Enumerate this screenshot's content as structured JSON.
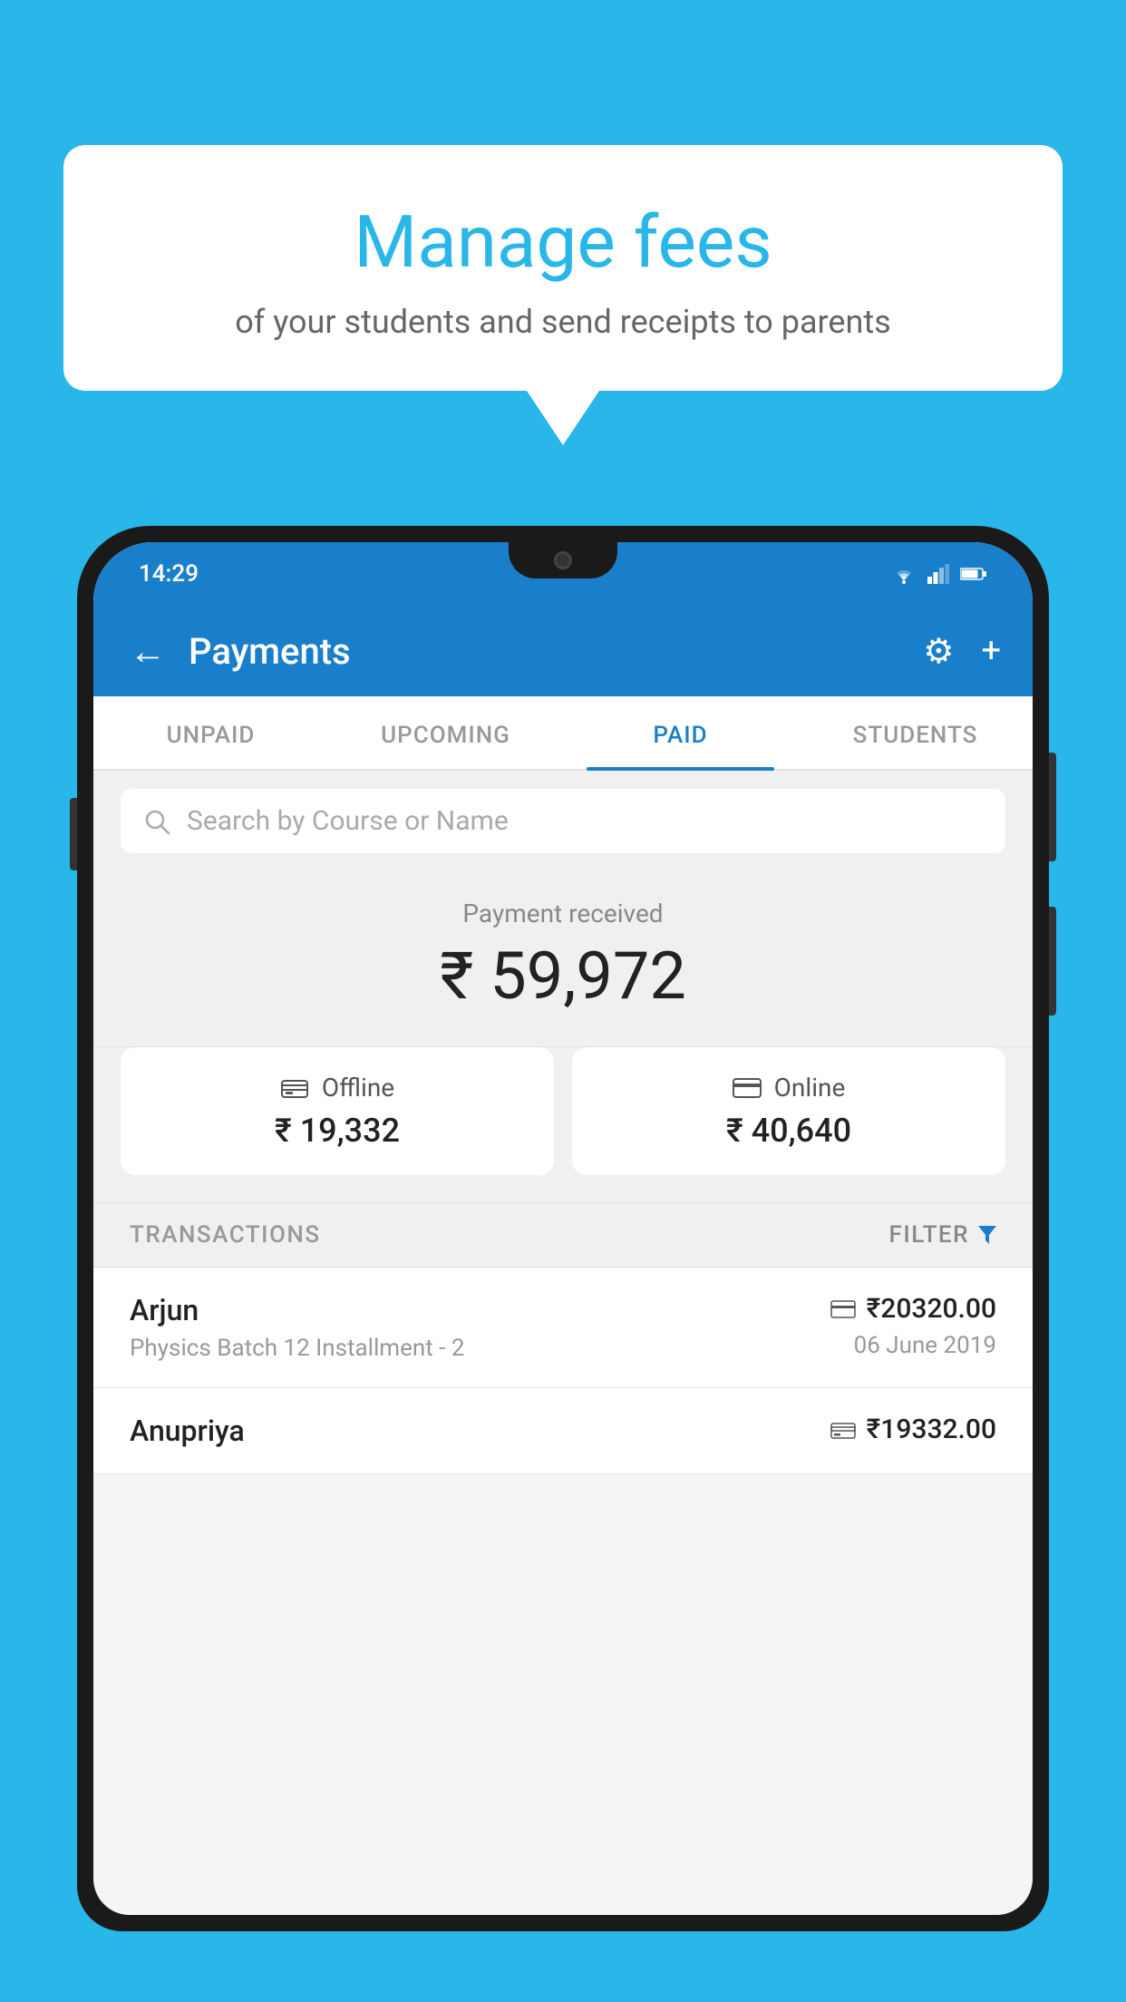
{
  "background": {
    "color": "#29b6e8"
  },
  "speech_bubble": {
    "title": "Manage fees",
    "subtitle": "of your students and send receipts to parents"
  },
  "status_bar": {
    "time": "14:29",
    "wifi": "▲",
    "signal": "▲",
    "battery": "▊"
  },
  "header": {
    "title": "Payments",
    "back_label": "←",
    "settings_label": "⚙",
    "add_label": "+"
  },
  "tabs": [
    {
      "label": "UNPAID",
      "active": false
    },
    {
      "label": "UPCOMING",
      "active": false
    },
    {
      "label": "PAID",
      "active": true
    },
    {
      "label": "STUDENTS",
      "active": false
    }
  ],
  "search": {
    "placeholder": "Search by Course or Name"
  },
  "payment_summary": {
    "label": "Payment received",
    "amount": "₹ 59,972"
  },
  "payment_methods": [
    {
      "name": "Offline",
      "amount": "₹ 19,332",
      "icon": "offline"
    },
    {
      "name": "Online",
      "amount": "₹ 40,640",
      "icon": "online"
    }
  ],
  "transactions_section": {
    "label": "TRANSACTIONS",
    "filter_label": "FILTER"
  },
  "transactions": [
    {
      "name": "Arjun",
      "detail": "Physics Batch 12 Installment - 2",
      "amount": "₹20320.00",
      "date": "06 June 2019",
      "payment_type": "card"
    },
    {
      "name": "Anupriya",
      "detail": "",
      "amount": "₹19332.00",
      "date": "",
      "payment_type": "offline"
    }
  ]
}
